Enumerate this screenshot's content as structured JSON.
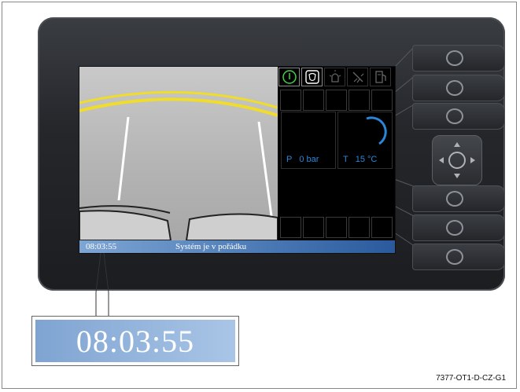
{
  "status_bar": {
    "time": "08:03:55",
    "message": "Systém je v pořádku"
  },
  "gauges": {
    "pressure": {
      "label": "P",
      "value": "0",
      "unit": "bar"
    },
    "temperature": {
      "label": "T",
      "value": "15",
      "unit": "°C"
    }
  },
  "status_icons": [
    {
      "name": "power-icon",
      "active": true,
      "color": "#3fd63f"
    },
    {
      "name": "seat-belt-icon",
      "active": true,
      "color": "#ffffff"
    },
    {
      "name": "warning-light-icon",
      "active": false,
      "color": "#555555"
    },
    {
      "name": "spray-icon",
      "active": false,
      "color": "#555555"
    },
    {
      "name": "fuel-icon",
      "active": false,
      "color": "#555555"
    }
  ],
  "zoom": {
    "time": "08:03:55"
  },
  "reference_code": "7377-OT1-D-CZ-G1",
  "colors": {
    "status_bar": "#4a78b4",
    "gauge_text": "#2a86d8",
    "guide_line_yellow": "#f0dc2a"
  }
}
